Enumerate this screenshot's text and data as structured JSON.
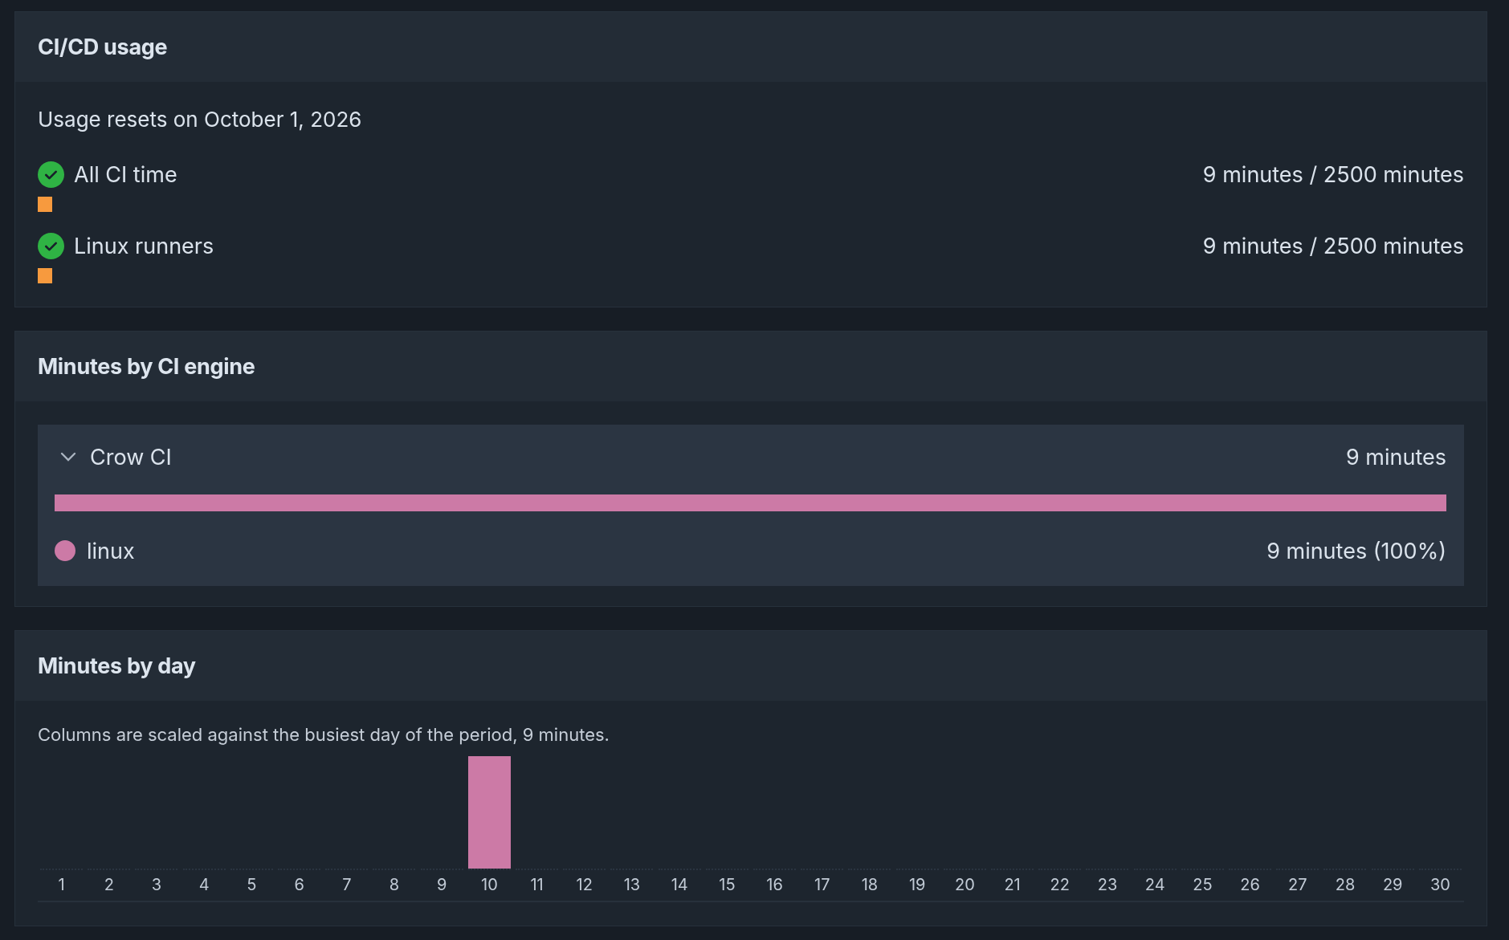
{
  "usage": {
    "title": "CI/CD usage",
    "resets": "Usage resets on October 1, 2026",
    "quotas": [
      {
        "label": "All CI time",
        "ok": true,
        "reading": "9 minutes / 2500 minutes",
        "level": 0.0036
      },
      {
        "label": "Linux runners",
        "ok": true,
        "reading": "9 minutes / 2500 minutes",
        "level": 0.0036
      }
    ]
  },
  "engines": {
    "title": "Minutes by CI engine",
    "groups": [
      {
        "name": "Crow CI",
        "expanded": true,
        "total": "9 minutes",
        "color": "#cc7aa6",
        "items": [
          {
            "name": "linux",
            "color": "#cc7aa6",
            "reading": "9 minutes (100%)"
          }
        ]
      }
    ]
  },
  "days": {
    "title": "Minutes by day",
    "caption": "Columns are scaled against the busiest day of the period, 9 minutes.",
    "columns": [
      {
        "label": "1",
        "level": 0
      },
      {
        "label": "2",
        "level": 0
      },
      {
        "label": "3",
        "level": 0
      },
      {
        "label": "4",
        "level": 0
      },
      {
        "label": "5",
        "level": 0
      },
      {
        "label": "6",
        "level": 0
      },
      {
        "label": "7",
        "level": 0
      },
      {
        "label": "8",
        "level": 0
      },
      {
        "label": "9",
        "level": 0
      },
      {
        "label": "10",
        "level": 1
      },
      {
        "label": "11",
        "level": 0
      },
      {
        "label": "12",
        "level": 0
      },
      {
        "label": "13",
        "level": 0
      },
      {
        "label": "14",
        "level": 0
      },
      {
        "label": "15",
        "level": 0
      },
      {
        "label": "16",
        "level": 0
      },
      {
        "label": "17",
        "level": 0
      },
      {
        "label": "18",
        "level": 0
      },
      {
        "label": "19",
        "level": 0
      },
      {
        "label": "20",
        "level": 0
      },
      {
        "label": "21",
        "level": 0
      },
      {
        "label": "22",
        "level": 0
      },
      {
        "label": "23",
        "level": 0
      },
      {
        "label": "24",
        "level": 0
      },
      {
        "label": "25",
        "level": 0
      },
      {
        "label": "26",
        "level": 0
      },
      {
        "label": "27",
        "level": 0
      },
      {
        "label": "28",
        "level": 0
      },
      {
        "label": "29",
        "level": 0
      },
      {
        "label": "30",
        "level": 0
      }
    ]
  }
}
